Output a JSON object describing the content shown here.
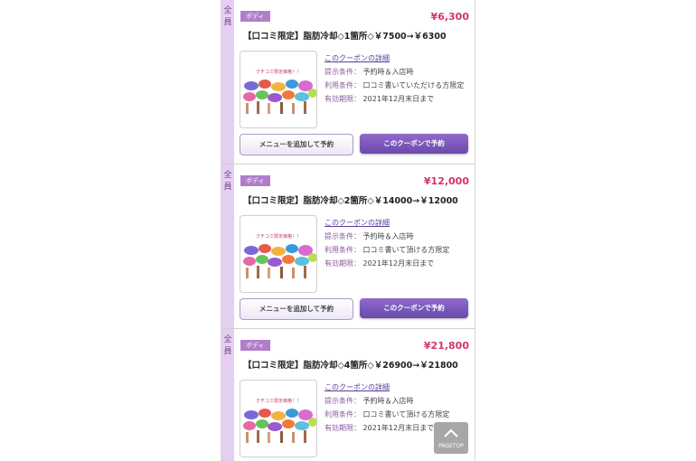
{
  "coupons": [
    {
      "side_label": [
        "全",
        "員"
      ],
      "tag": "ボディ",
      "price": "¥6,300",
      "title": "【口コミ限定】脂肪冷却◇1箇所◇￥7500→￥6300",
      "thumb_caption": "クチコミ限定価格！！",
      "details_link": "このクーポンの詳細",
      "present_label": "提示条件：",
      "present_value": "予約時＆入店時",
      "use_label": "利用条件：",
      "use_value": "口コミ書いていただける方限定",
      "expiry_label": "有効期限：",
      "expiry_value": "2021年12月末日まで",
      "btn_add_menu": "メニューを追加して予約",
      "btn_reserve": "このクーポンで予約"
    },
    {
      "side_label": [
        "全",
        "員"
      ],
      "tag": "ボディ",
      "price": "¥12,000",
      "title": "【口コミ限定】脂肪冷却◇2箇所◇￥14000→￥12000",
      "thumb_caption": "クチコミ限定価格！！",
      "details_link": "このクーポンの詳細",
      "present_label": "提示条件：",
      "present_value": "予約時＆入店時",
      "use_label": "利用条件：",
      "use_value": "口コミ書いて頂ける方限定",
      "expiry_label": "有効期限：",
      "expiry_value": "2021年12月末日まで",
      "btn_add_menu": "メニューを追加して予約",
      "btn_reserve": "このクーポンで予約"
    },
    {
      "side_label": [
        "全",
        "員"
      ],
      "tag": "ボディ",
      "price": "¥21,800",
      "title": "【口コミ限定】脂肪冷却◇4箇所◇￥26900→￥21800",
      "thumb_caption": "クチコミ限定価格！！",
      "details_link": "このクーポンの詳細",
      "present_label": "提示条件：",
      "present_value": "予約時＆入店時",
      "use_label": "利用条件：",
      "use_value": "口コミ書いて頂ける方限定",
      "expiry_label": "有効期限：",
      "expiry_value": "2021年12月末日まで"
    }
  ],
  "pagetop": {
    "label": "PAGETOP",
    "icon": "chevron-up-icon"
  },
  "colors": {
    "accent": "#6a4aad",
    "price": "#d6336c",
    "tag": "#b07ec9",
    "side": "#e4cff0"
  }
}
